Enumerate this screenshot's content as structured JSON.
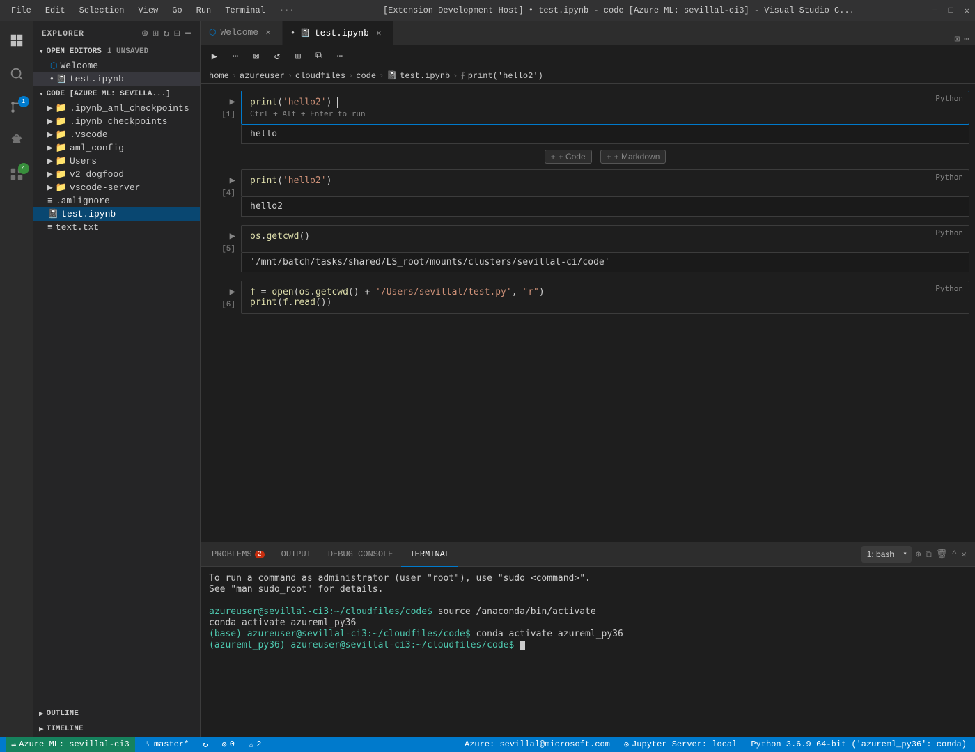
{
  "titlebar": {
    "menu_items": [
      "File",
      "Edit",
      "Selection",
      "View",
      "Go",
      "Run",
      "Terminal",
      "···"
    ],
    "title": "[Extension Development Host] • test.ipynb - code [Azure ML: sevillal-ci3] - Visual Studio C...",
    "selection_label": "Selection"
  },
  "tabs": {
    "welcome": {
      "label": "Welcome",
      "icon": "vscode-icon"
    },
    "notebook": {
      "label": "test.ipynb",
      "unsaved": true
    }
  },
  "breadcrumb": {
    "items": [
      "home",
      "azureuser",
      "cloudfiles",
      "code",
      "test.ipynb",
      "print('hello2')"
    ],
    "icons": [
      "folder",
      "folder",
      "folder",
      "folder",
      "notebook",
      "function"
    ]
  },
  "sidebar": {
    "title": "EXPLORER",
    "sections": {
      "open_editors": {
        "label": "OPEN EDITORS",
        "badge": "1 UNSAVED",
        "items": [
          {
            "icon": "vscode",
            "label": "Welcome"
          },
          {
            "icon": "notebook",
            "label": "test.ipynb",
            "unsaved": true
          }
        ]
      },
      "explorer": {
        "label": "CODE [AZURE ML: SEVILLA...]",
        "items": [
          {
            "label": ".ipynb_aml_checkpoints",
            "type": "folder"
          },
          {
            "label": ".ipynb_checkpoints",
            "type": "folder"
          },
          {
            "label": ".vscode",
            "type": "folder"
          },
          {
            "label": "aml_config",
            "type": "folder"
          },
          {
            "label": "Users",
            "type": "folder"
          },
          {
            "label": "v2_dogfood",
            "type": "folder"
          },
          {
            "label": "vscode-server",
            "type": "folder"
          },
          {
            "label": ".amlignore",
            "type": "file-text"
          },
          {
            "label": "test.ipynb",
            "type": "notebook",
            "selected": true
          },
          {
            "label": "text.txt",
            "type": "file-text"
          }
        ]
      },
      "outline": {
        "label": "OUTLINE"
      },
      "timeline": {
        "label": "TIMELINE"
      }
    }
  },
  "cells": [
    {
      "number": "[1]",
      "type": "code",
      "focused": true,
      "code_html": "<span class='fn'>print</span><span class='punc'>(</span><span class='str'>'hello2'</span><span class='punc'>)</span>",
      "hint": "Ctrl + Alt + Enter to run",
      "lang": "Python",
      "output": "hello"
    },
    {
      "number": "[4]",
      "type": "code",
      "focused": false,
      "code_html": "<span class='fn'>print</span><span class='punc'>(</span><span class='str'>'hello2'</span><span class='punc'>)</span>",
      "lang": "Python",
      "output": "hello2"
    },
    {
      "number": "[5]",
      "type": "code",
      "focused": false,
      "code_html": "<span class='fn'>os</span><span class='punc'>.</span><span class='fn'>getcwd</span><span class='punc'>()</span>",
      "lang": "Python",
      "output": "'/mnt/batch/tasks/shared/LS_root/mounts/clusters/sevillal-ci/code'"
    },
    {
      "number": "[6]",
      "type": "code",
      "focused": false,
      "code_html": "<span class='fn'>f</span> <span class='punc'>=</span> <span class='fn'>open</span><span class='punc'>(</span><span class='fn'>os</span><span class='punc'>.</span><span class='fn'>getcwd</span><span class='punc'>() +</span> <span class='path-str'>'/Users/sevillal/test.py'</span><span class='punc'>,</span> <span class='str'>\"r\"</span><span class='punc'>)</span><br><span class='fn'>print</span><span class='punc'>(</span><span class='fn'>f</span><span class='punc'>.</span><span class='fn'>read</span><span class='punc'>())</span>",
      "lang": "Python",
      "output": null
    }
  ],
  "terminal": {
    "tabs": [
      {
        "label": "PROBLEMS",
        "badge": "2",
        "active": false
      },
      {
        "label": "OUTPUT",
        "active": false
      },
      {
        "label": "DEBUG CONSOLE",
        "active": false
      },
      {
        "label": "TERMINAL",
        "active": true
      }
    ],
    "shell_label": "1: bash",
    "lines": [
      {
        "type": "text",
        "content": "To run a command as administrator (user \"root\"), use \"sudo <command>\"."
      },
      {
        "type": "text",
        "content": "See \"man sudo_root\" for details."
      },
      {
        "type": "blank"
      },
      {
        "type": "prompt_cmd",
        "prompt": "azureuser@sevillal-ci3:~/cloudfiles/code$",
        "cmd": " source /anaconda/bin/activate"
      },
      {
        "type": "text",
        "content": "conda activate azureml_py36"
      },
      {
        "type": "prompt_cmd",
        "prompt": "(base) azureuser@sevillal-ci3:~/cloudfiles/code$",
        "cmd": " conda activate azureml_py36"
      },
      {
        "type": "prompt_cursor",
        "prompt": "(azureml_py36) azureuser@sevillal-ci3:~/cloudfiles/code$"
      }
    ]
  },
  "statusbar": {
    "left": [
      {
        "icon": "remote-icon",
        "label": "Azure ML: sevillal-ci3"
      },
      {
        "icon": "branch-icon",
        "label": "master*"
      },
      {
        "icon": "sync-icon",
        "label": ""
      },
      {
        "icon": "error-icon",
        "label": "0"
      },
      {
        "icon": "warning-icon",
        "label": "2"
      }
    ],
    "right": [
      {
        "label": "Azure: sevillal@microsoft.com"
      },
      {
        "icon": "jupyter-icon",
        "label": "Jupyter Server: local"
      },
      {
        "label": "Python 3.6.9 64-bit ('azureml_py36': conda)"
      }
    ]
  },
  "add_cell_labels": {
    "code": "+ Code",
    "markdown": "+ Markdown"
  }
}
